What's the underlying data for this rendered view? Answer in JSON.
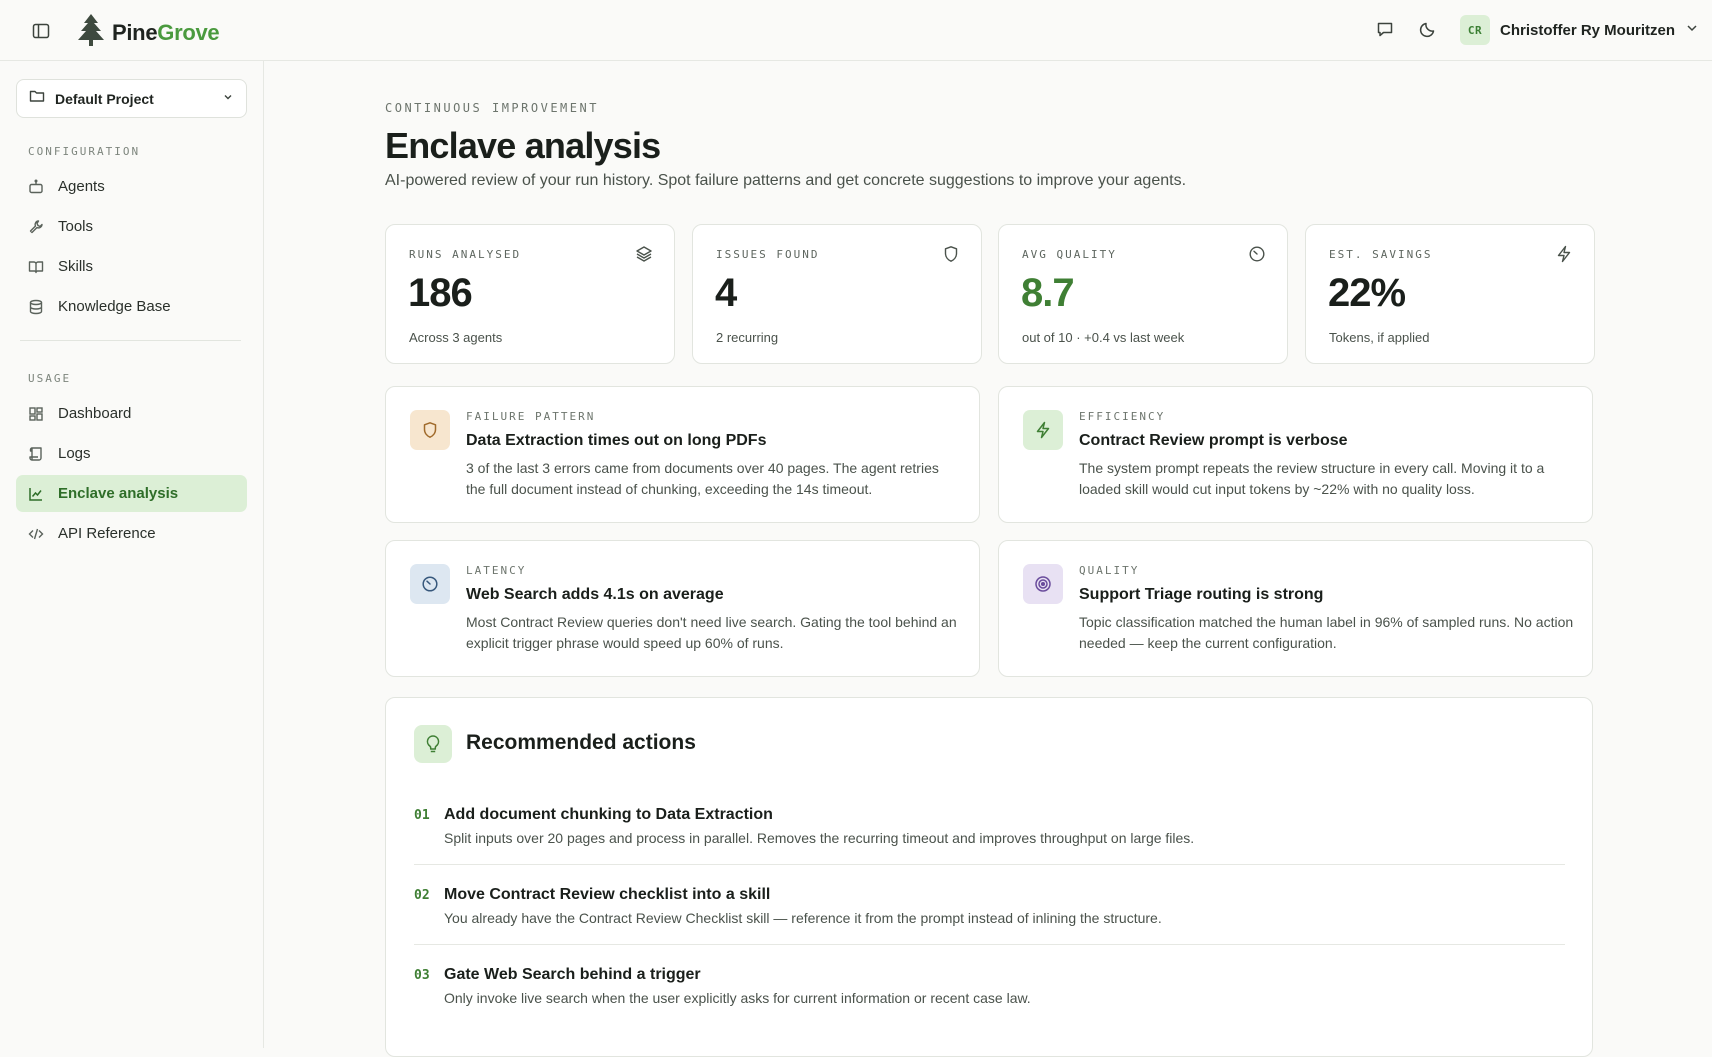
{
  "app": {
    "brand_prefix": "Pine",
    "brand_suffix": "Grove",
    "accent": "#4a9a3e"
  },
  "topbar": {
    "user_initials": "CR",
    "user_name": "Christoffer Ry Mouritzen"
  },
  "sidebar": {
    "project": "Default Project",
    "config_title": "CONFIGURATION",
    "config_items": [
      {
        "label": "Agents",
        "icon": "robot-icon"
      },
      {
        "label": "Tools",
        "icon": "wrench-icon"
      },
      {
        "label": "Skills",
        "icon": "book-icon"
      },
      {
        "label": "Knowledge Base",
        "icon": "database-icon"
      }
    ],
    "usage_title": "USAGE",
    "usage_items": [
      {
        "label": "Dashboard",
        "icon": "grid-icon"
      },
      {
        "label": "Logs",
        "icon": "scroll-icon"
      },
      {
        "label": "Enclave analysis",
        "icon": "chart-line-icon",
        "active": true
      },
      {
        "label": "API Reference",
        "icon": "code-icon"
      }
    ]
  },
  "header": {
    "eyebrow": "CONTINUOUS IMPROVEMENT",
    "title": "Enclave analysis",
    "subtitle": "AI-powered review of your run history. Spot failure patterns and get concrete suggestions to improve your agents."
  },
  "stats": [
    {
      "label": "RUNS ANALYSED",
      "value": "186",
      "caption": "Across 3 agents",
      "icon": "layers-icon"
    },
    {
      "label": "ISSUES FOUND",
      "value": "4",
      "caption": "2 recurring",
      "icon": "shield-icon"
    },
    {
      "label": "AVG QUALITY",
      "value": "8.7",
      "caption": "out of 10 · +0.4 vs last week",
      "icon": "gauge-icon"
    },
    {
      "label": "EST. SAVINGS",
      "value": "22%",
      "caption": "Tokens, if applied",
      "icon": "lightning-icon"
    }
  ],
  "insights": [
    {
      "category": "FAILURE PATTERN",
      "title": "Data Extraction times out on long PDFs",
      "body": "3 of the last 3 errors came from documents over 40 pages. The agent retries the full document instead of chunking, exceeding the 14s timeout.",
      "icon": "shield-icon",
      "tint": "#f7e6cf"
    },
    {
      "category": "EFFICIENCY",
      "title": "Contract Review prompt is verbose",
      "body": "The system prompt repeats the review structure in every call. Moving it to a loaded skill would cut input tokens by ~22% with no quality loss.",
      "icon": "lightning-icon",
      "tint": "#dcefd6"
    },
    {
      "category": "LATENCY",
      "title": "Web Search adds 4.1s on average",
      "body": "Most Contract Review queries don't need live search. Gating the tool behind an explicit trigger phrase would speed up 60% of runs.",
      "icon": "gauge-icon",
      "tint": "#dde7f1"
    },
    {
      "category": "QUALITY",
      "title": "Support Triage routing is strong",
      "body": "Topic classification matched the human label in 96% of sampled runs. No action needed — keep the current configuration.",
      "icon": "target-icon",
      "tint": "#e8e1f3"
    }
  ],
  "actions": {
    "title": "Recommended actions",
    "items": [
      {
        "num": "01",
        "title": "Add document chunking to Data Extraction",
        "desc": "Split inputs over 20 pages and process in parallel. Removes the recurring timeout and improves throughput on large files."
      },
      {
        "num": "02",
        "title": "Move Contract Review checklist into a skill",
        "desc": "You already have the Contract Review Checklist skill — reference it from the prompt instead of inlining the structure."
      },
      {
        "num": "03",
        "title": "Gate Web Search behind a trigger",
        "desc": "Only invoke live search when the user explicitly asks for current information or recent case law."
      }
    ]
  }
}
